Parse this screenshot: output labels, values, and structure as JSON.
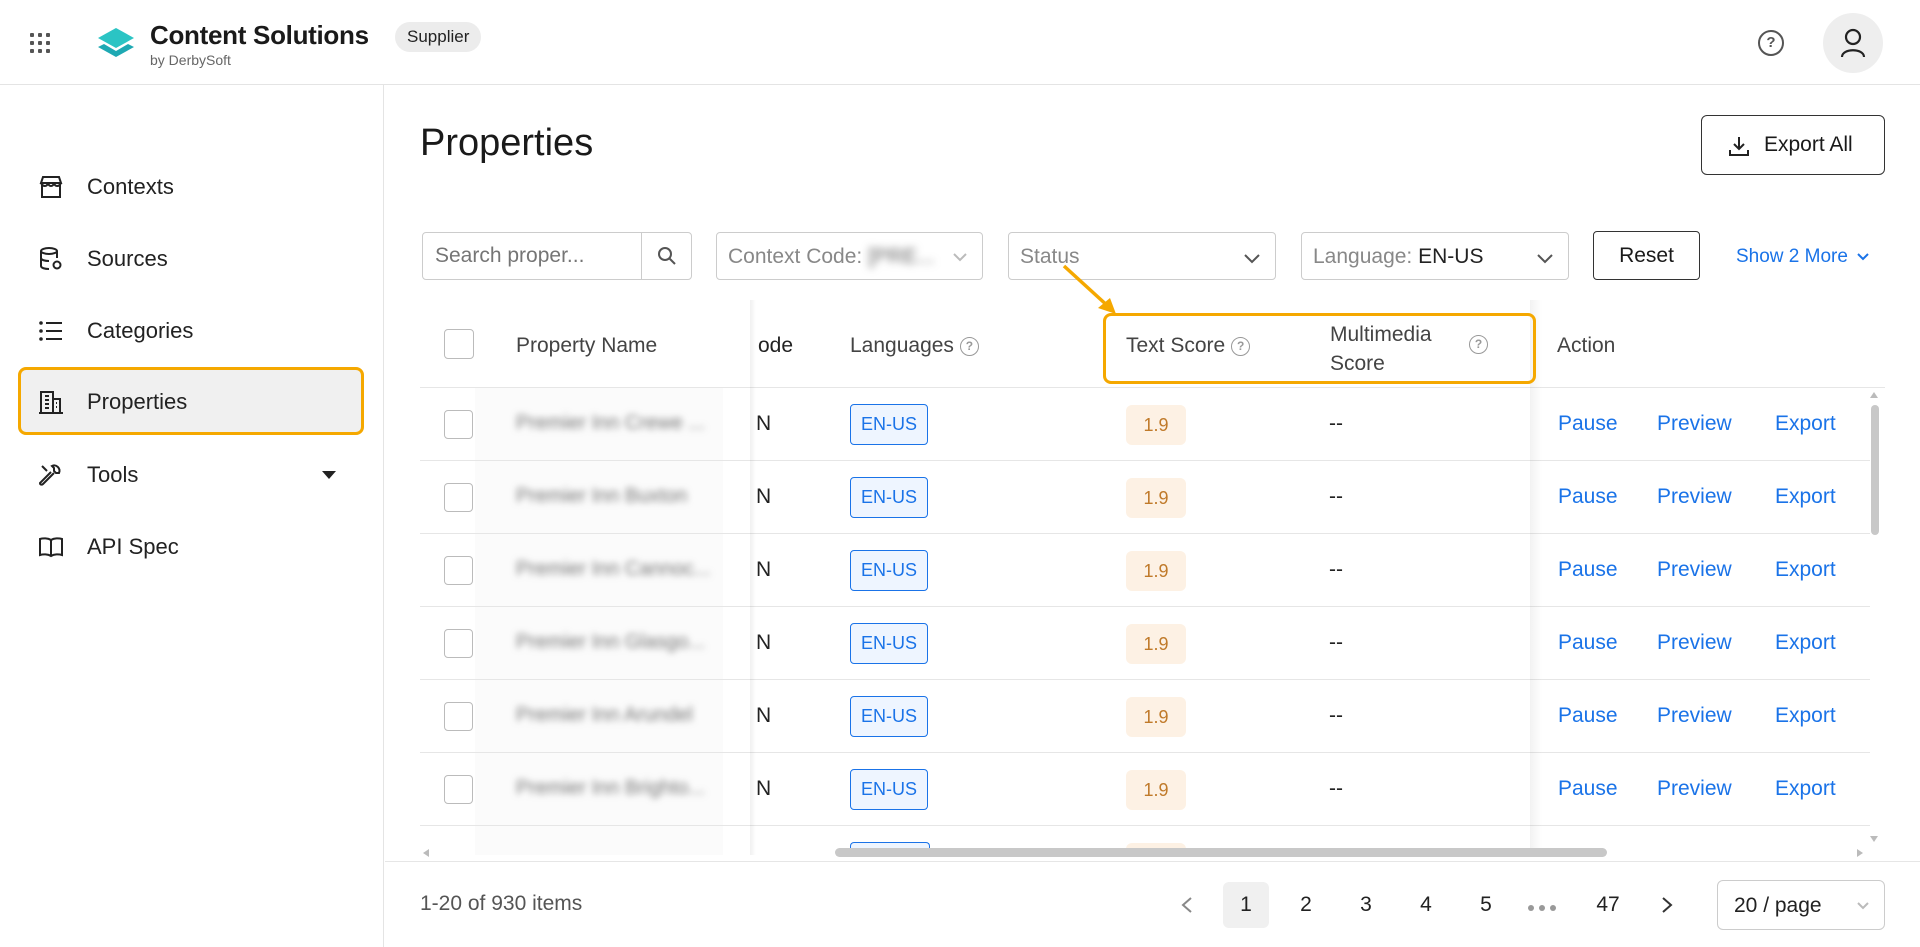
{
  "header": {
    "brand_title": "Content Solutions",
    "brand_sub": "by DerbySoft",
    "role_badge": "Supplier",
    "icons": [
      "apps-grid-icon",
      "logo-icon",
      "help-icon",
      "user-icon"
    ]
  },
  "sidebar": {
    "items": [
      {
        "label": "Contexts",
        "icon": "store-icon"
      },
      {
        "label": "Sources",
        "icon": "database-icon"
      },
      {
        "label": "Categories",
        "icon": "list-icon"
      },
      {
        "label": "Properties",
        "icon": "building-icon",
        "active": true
      },
      {
        "label": "Tools",
        "icon": "wrench-icon"
      },
      {
        "label": "API Spec",
        "icon": "book-icon"
      }
    ]
  },
  "main": {
    "title": "Properties",
    "export_all": "Export All",
    "filters": {
      "search_placeholder": "Search proper...",
      "context_code_label": "Context Code:",
      "context_code_value": "[PRE...",
      "status_placeholder": "Status",
      "language_label": "Language:",
      "language_value": "EN-US",
      "reset": "Reset",
      "show_more": "Show 2 More"
    },
    "table": {
      "columns": {
        "property_name": "Property Name",
        "code": "ode",
        "languages": "Languages",
        "text_score": "Text Score",
        "multimedia_score_1": "Multimedia",
        "multimedia_score_2": "Score",
        "action": "Action"
      },
      "rows": [
        {
          "name": "Premier Inn Crewe ...",
          "code": "N",
          "language": "EN-US",
          "text_score": "1.9",
          "multimedia_score": "--",
          "actions": [
            "Pause",
            "Preview",
            "Export"
          ]
        },
        {
          "name": "Premier Inn Buxton",
          "code": "N",
          "language": "EN-US",
          "text_score": "1.9",
          "multimedia_score": "--",
          "actions": [
            "Pause",
            "Preview",
            "Export"
          ]
        },
        {
          "name": "Premier Inn Cannoc...",
          "code": "N",
          "language": "EN-US",
          "text_score": "1.9",
          "multimedia_score": "--",
          "actions": [
            "Pause",
            "Preview",
            "Export"
          ]
        },
        {
          "name": "Premier Inn Glasgo...",
          "code": "N",
          "language": "EN-US",
          "text_score": "1.9",
          "multimedia_score": "--",
          "actions": [
            "Pause",
            "Preview",
            "Export"
          ]
        },
        {
          "name": "Premier Inn Arundel",
          "code": "N",
          "language": "EN-US",
          "text_score": "1.9",
          "multimedia_score": "--",
          "actions": [
            "Pause",
            "Preview",
            "Export"
          ]
        },
        {
          "name": "Premier Inn Brighto...",
          "code": "N",
          "language": "EN-US",
          "text_score": "1.9",
          "multimedia_score": "--",
          "actions": [
            "Pause",
            "Preview",
            "Export"
          ]
        }
      ]
    },
    "pagination": {
      "total_text": "1-20 of 930 items",
      "pages": [
        "1",
        "2",
        "3",
        "4",
        "5"
      ],
      "last_page": "47",
      "current_page": "1",
      "page_size": "20 / page"
    }
  },
  "colors": {
    "accent": "#1a73e8",
    "highlight": "#f5a800",
    "score_text": "#c07a2a",
    "score_bg": "#fdf1e4",
    "brand": "#2bc4c4"
  }
}
